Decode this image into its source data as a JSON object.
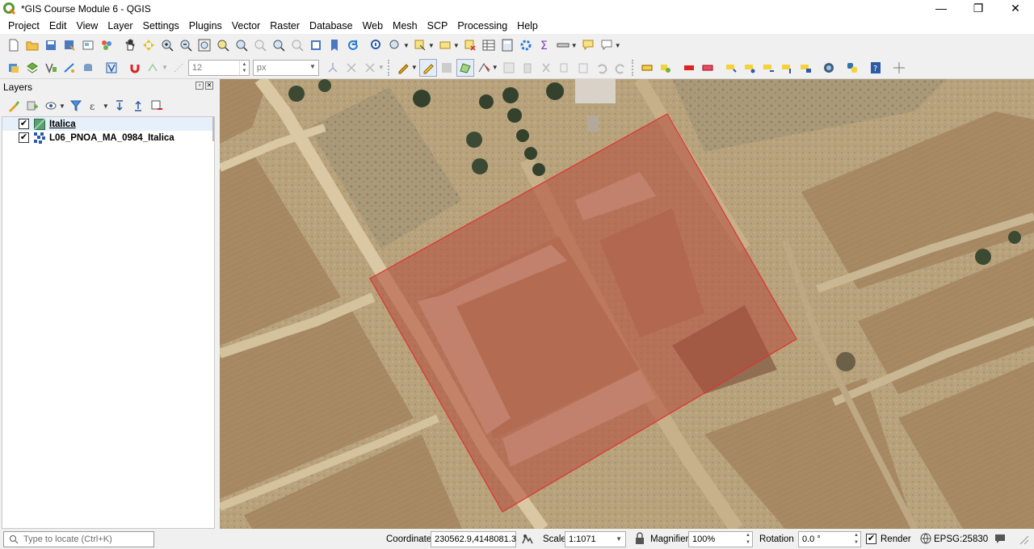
{
  "window": {
    "title": "*GIS Course Module 6 - QGIS",
    "minimize": "—",
    "restore": "❐",
    "close": "✕"
  },
  "menu": [
    "Project",
    "Edit",
    "View",
    "Layer",
    "Settings",
    "Plugins",
    "Vector",
    "Raster",
    "Database",
    "Web",
    "Mesh",
    "SCP",
    "Processing",
    "Help"
  ],
  "digitizing": {
    "size_value": "12",
    "unit_value": "px"
  },
  "layers_panel": {
    "title": "Layers",
    "layers": [
      {
        "name": "Italica",
        "checked": true,
        "selected": true,
        "icon": "polygon-layer-icon"
      },
      {
        "name": "L06_PNOA_MA_0984_Italica",
        "checked": true,
        "selected": false,
        "icon": "raster-layer-icon"
      }
    ]
  },
  "status": {
    "locate_placeholder": "Type to locate (Ctrl+K)",
    "coordinate_label": "Coordinate",
    "coordinate_value": "230562.9,4148081.3",
    "scale_label": "Scale",
    "scale_value": "1:1071",
    "magnifier_label": "Magnifier",
    "magnifier_value": "100%",
    "rotation_label": "Rotation",
    "rotation_value": "0.0 °",
    "render_label": "Render",
    "render_checked": true,
    "crs_label": "EPSG:25830"
  },
  "colors": {
    "polygon_fill": "#b34a3a",
    "polygon_stroke": "#e0332f",
    "qgis_green": "#589632"
  }
}
